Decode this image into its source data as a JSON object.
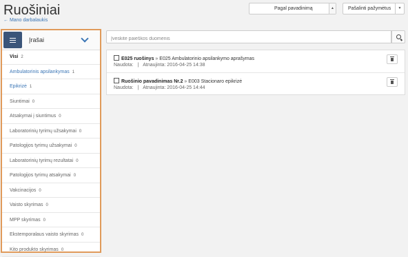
{
  "header": {
    "title": "Ruošiniai",
    "back_link": "← Mano darbalaukis",
    "sort_select": {
      "value": "Pagal pavadinimą"
    },
    "remove_button": {
      "label": "Pašalinti pažymėtus"
    }
  },
  "sidebar": {
    "header_label": "Įrašai",
    "items": [
      {
        "label": "Visi",
        "count": "2",
        "state": "active"
      },
      {
        "label": "Ambulatorinis apsilankymas",
        "count": "1",
        "state": "link"
      },
      {
        "label": "Epikrizė",
        "count": "1",
        "state": "link"
      },
      {
        "label": "Siuntimai",
        "count": "0",
        "state": ""
      },
      {
        "label": "Atsakymai į siuntimus",
        "count": "0",
        "state": ""
      },
      {
        "label": "Laboratorinių tyrimų užsakymai",
        "count": "0",
        "state": ""
      },
      {
        "label": "Patologijos tyrimų užsakymai",
        "count": "0",
        "state": ""
      },
      {
        "label": "Laboratorinių tyrimų rezultatai",
        "count": "0",
        "state": ""
      },
      {
        "label": "Patologijos tyrimų atsakymai",
        "count": "0",
        "state": ""
      },
      {
        "label": "Vakcinacijos",
        "count": "0",
        "state": ""
      },
      {
        "label": "Vaisto skyrimas",
        "count": "0",
        "state": ""
      },
      {
        "label": "MPP skyrimas",
        "count": "0",
        "state": ""
      },
      {
        "label": "Ekstemporalaus vaisto skyrimas",
        "count": "0",
        "state": ""
      },
      {
        "label": "Kito produkto skyrimas",
        "count": "0",
        "state": ""
      }
    ]
  },
  "search": {
    "placeholder": "Įveskite paieškos duomenis",
    "value": ""
  },
  "results": [
    {
      "title": "E025 ruošinys",
      "separator": "»",
      "doc_type": "E025 Ambulatorinio apsilankymo aprašymas",
      "used_label": "Naudota:",
      "pipe": "|",
      "updated_label": "Atnaujinta:",
      "updated": "2016-04-25 14:38"
    },
    {
      "title": "Ruošinio pavadinimas Nr.2",
      "separator": "»",
      "doc_type": "E003 Stacionaro epikrizė",
      "used_label": "Naudota:",
      "pipe": "|",
      "updated_label": "Atnaujinta:",
      "updated": "2016-04-25 14:44"
    }
  ],
  "colors": {
    "accent": "#3b5579",
    "link": "#3a75b5",
    "highlight_border": "#e09a5a"
  },
  "icons": {
    "sidebar_toggle": "list-icon",
    "sidebar_expand": "chevron-down-icon",
    "search": "search-icon",
    "delete": "trash-icon"
  }
}
